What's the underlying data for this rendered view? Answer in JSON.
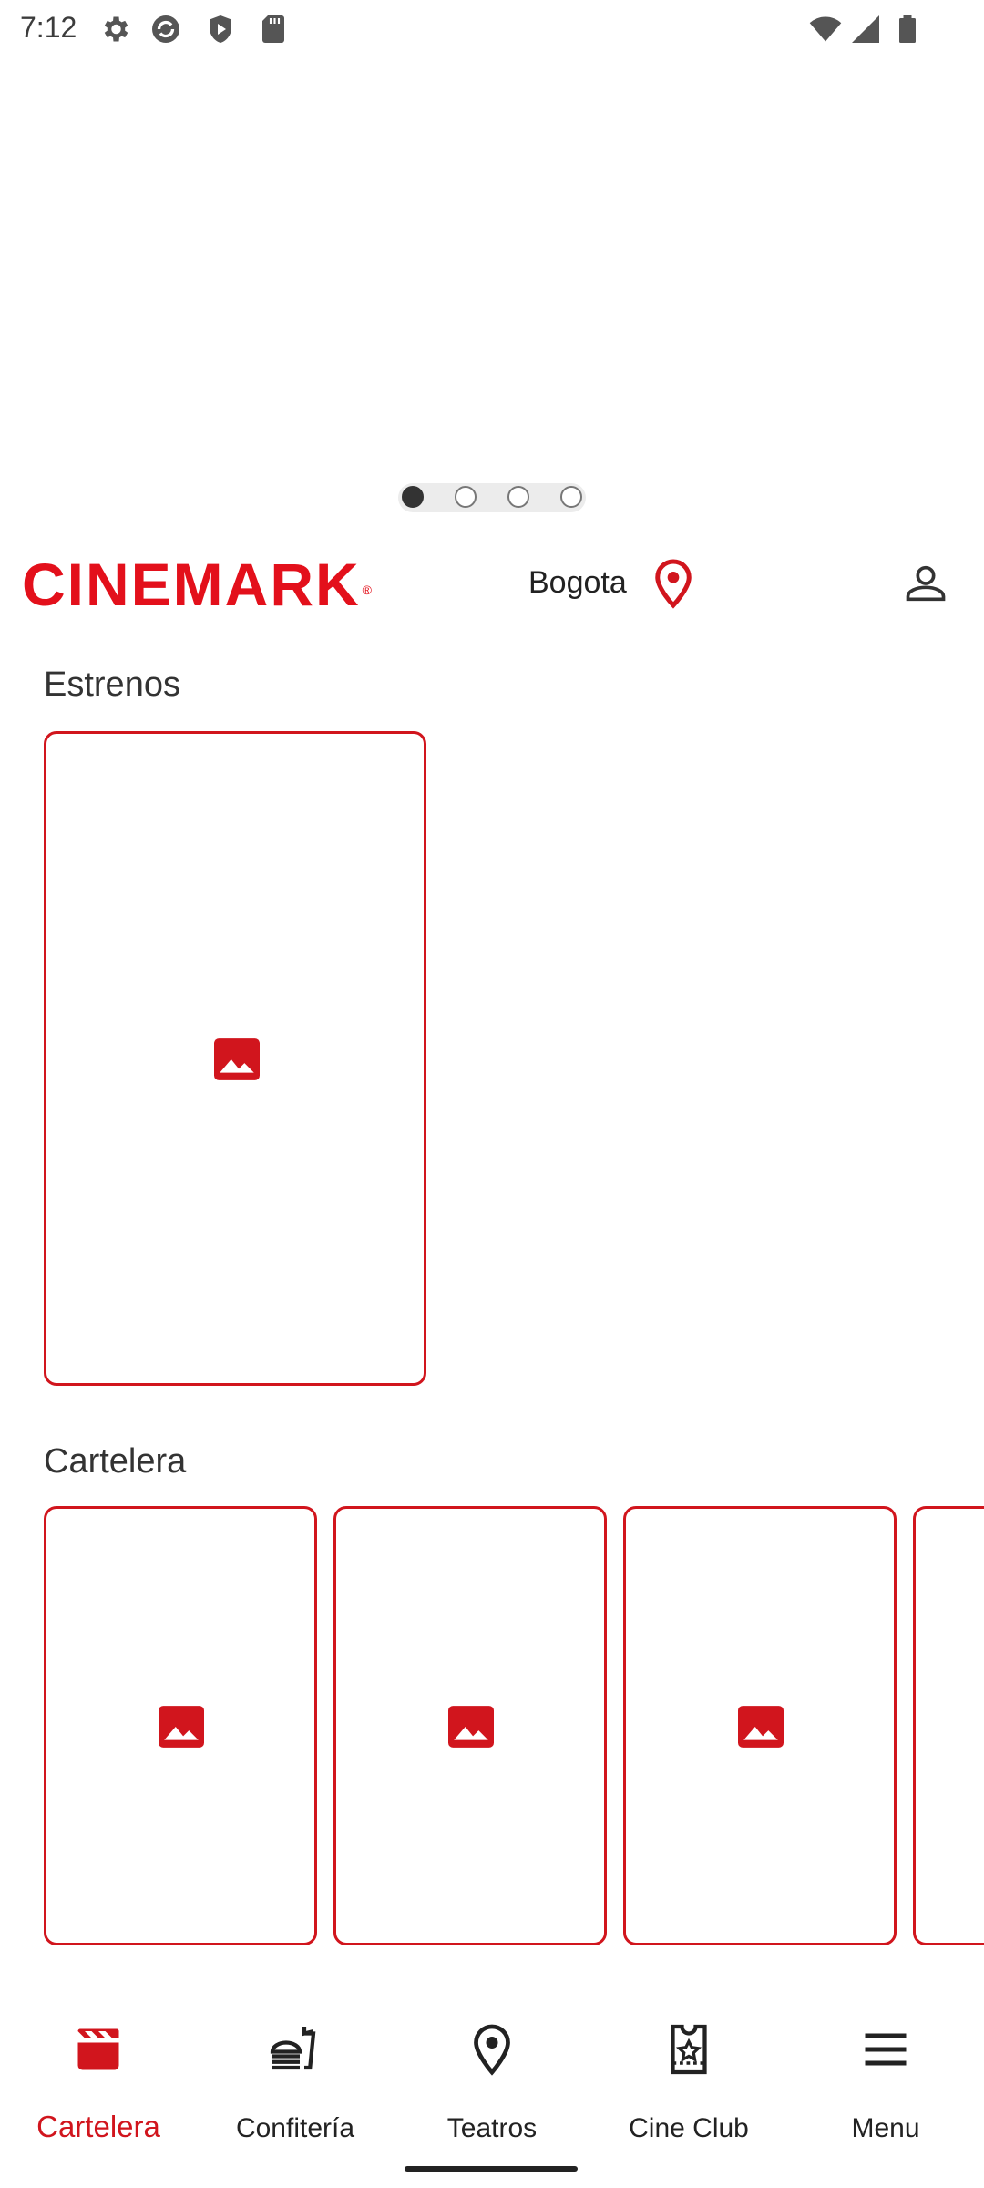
{
  "status_bar": {
    "time": "7:12",
    "left_icons": [
      "gear-icon",
      "sync-icon",
      "shield-play-icon",
      "sd-card-icon"
    ],
    "right_icons": [
      "wifi-icon",
      "signal-icon",
      "battery-icon"
    ]
  },
  "carousel": {
    "slide_count": 4,
    "active_index": 0
  },
  "header": {
    "logo": "CINEMARK",
    "logo_mark": "®",
    "city": "Bogota",
    "location_icon": "map-pin-icon",
    "profile_icon": "user-icon"
  },
  "sections": {
    "estrenos": {
      "title": "Estrenos"
    },
    "cartelera": {
      "title": "Cartelera"
    }
  },
  "bottom_nav": [
    {
      "label": "Cartelera",
      "icon": "clapperboard-icon",
      "active": true
    },
    {
      "label": "Confitería",
      "icon": "food-drink-icon",
      "active": false
    },
    {
      "label": "Teatros",
      "icon": "map-pin-icon",
      "active": false
    },
    {
      "label": "Cine Club",
      "icon": "ticket-star-icon",
      "active": false
    },
    {
      "label": "Menu",
      "icon": "hamburger-icon",
      "active": false
    }
  ],
  "colors": {
    "brand_red": "#e3101b",
    "accent_red": "#d1151d",
    "text": "#222222"
  }
}
